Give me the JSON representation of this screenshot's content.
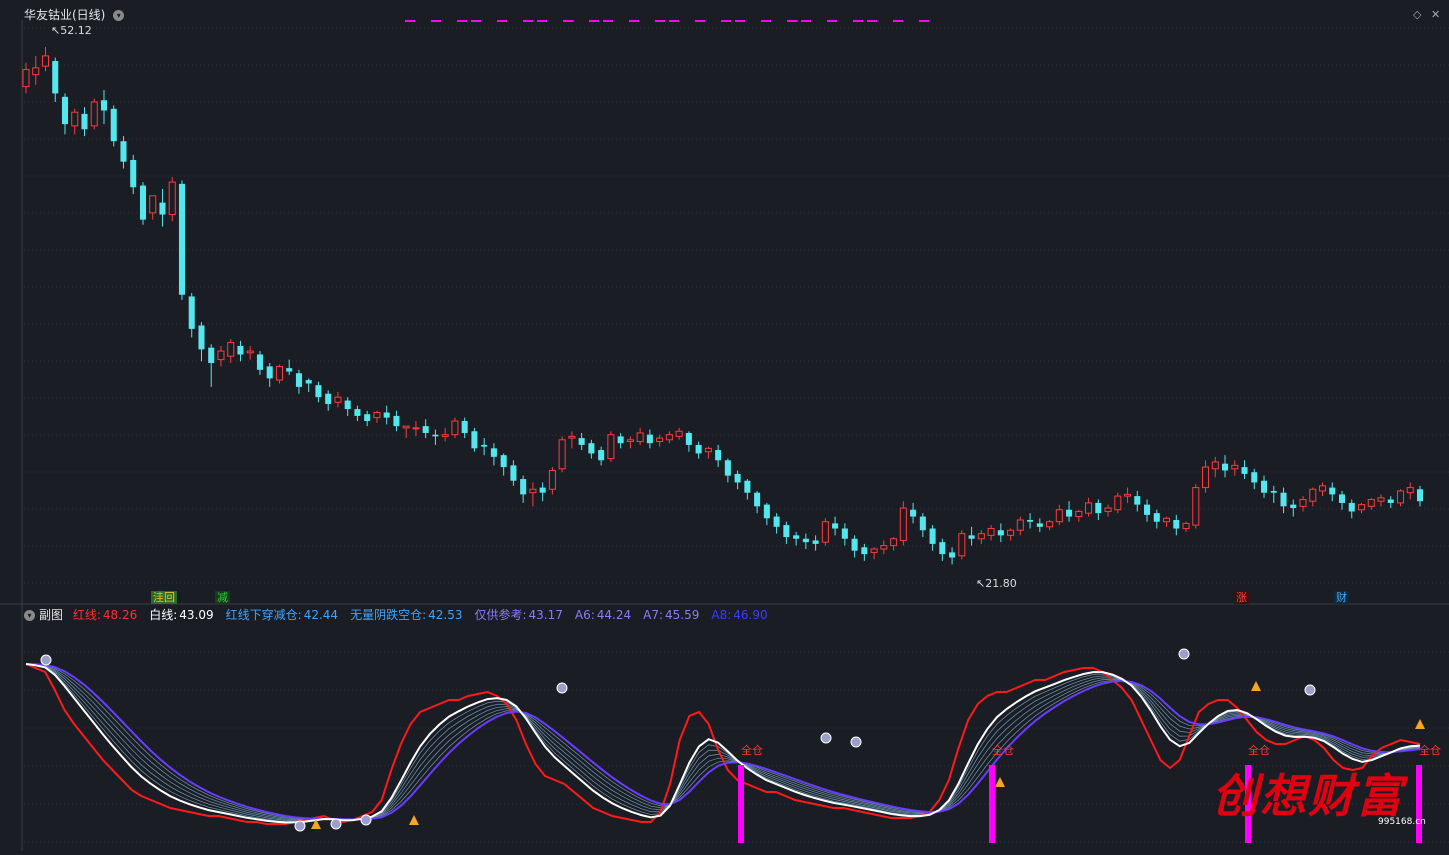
{
  "window": {
    "title": "华友钴业(日线)",
    "subchart_label": "副图"
  },
  "main_chart": {
    "high_label": "52.12",
    "low_label": "21.80",
    "markers": [
      {
        "text": "洼回",
        "color": "#f0c419"
      },
      {
        "text": "减",
        "color": "#2ec84a"
      },
      {
        "text": "涨",
        "color": "#ff4040"
      },
      {
        "text": "财",
        "color": "#41a7ff"
      }
    ]
  },
  "indicator": {
    "items": [
      {
        "name": "红线:",
        "value": "48.26",
        "name_color": "#ff3030",
        "value_color": "#ff3030"
      },
      {
        "name": "白线:",
        "value": "43.09",
        "name_color": "#ffffff",
        "value_color": "#ffffff"
      },
      {
        "name": "红线下穿减仓:",
        "value": "42.44",
        "name_color": "#3fa5ff",
        "value_color": "#3fa5ff"
      },
      {
        "name": "无量阴跌空仓:",
        "value": "42.53",
        "name_color": "#3fa5ff",
        "value_color": "#3fa5ff"
      },
      {
        "name": "仅供参考:",
        "value": "43.17",
        "name_color": "#8a7bff",
        "value_color": "#8a7bff"
      },
      {
        "name": "A6:",
        "value": "44.24",
        "name_color": "#8a7bff",
        "value_color": "#8a7bff"
      },
      {
        "name": "A7:",
        "value": "45.59",
        "name_color": "#8a7bff",
        "value_color": "#8a7bff"
      },
      {
        "name": "A8:",
        "value": "46.90",
        "name_color": "#3c3cff",
        "value_color": "#3c3cff"
      }
    ],
    "quan_label": "全仓"
  },
  "watermark": {
    "text": "创想财富",
    "url": "995168.cn"
  },
  "colors": {
    "up": "#ff3b3b",
    "down": "#54e8ee",
    "red_line": "#ff1a1a",
    "white_line": "#ffffff",
    "blue_line": "#6a3cff",
    "signal": "#ff00ff"
  },
  "chart_data": {
    "type": "candlestick",
    "ylim": [
      21.0,
      53.0
    ],
    "candles": [
      [
        49.8,
        51.2,
        50.8,
        49.4
      ],
      [
        50.5,
        51.6,
        50.9,
        49.9
      ],
      [
        51.0,
        52.12,
        51.6,
        50.7
      ],
      [
        51.3,
        51.5,
        49.4,
        48.9
      ],
      [
        49.2,
        49.4,
        47.6,
        47.0
      ],
      [
        47.5,
        48.5,
        48.3,
        47.0
      ],
      [
        48.2,
        48.6,
        47.3,
        46.9
      ],
      [
        47.5,
        49.1,
        48.9,
        47.3
      ],
      [
        49.0,
        49.6,
        48.4,
        47.6
      ],
      [
        48.5,
        48.7,
        46.6,
        46.3
      ],
      [
        46.6,
        46.9,
        45.4,
        45.0
      ],
      [
        45.5,
        45.8,
        43.9,
        43.5
      ],
      [
        44.0,
        44.2,
        42.0,
        41.7
      ],
      [
        42.4,
        42.8,
        43.4,
        42.0
      ],
      [
        43.0,
        43.8,
        42.3,
        41.6
      ],
      [
        42.3,
        44.5,
        44.2,
        41.9
      ],
      [
        44.1,
        44.3,
        37.6,
        37.3
      ],
      [
        37.5,
        37.7,
        35.6,
        35.1
      ],
      [
        35.8,
        36.0,
        34.4,
        33.7
      ],
      [
        34.5,
        34.7,
        33.6,
        32.2
      ],
      [
        33.8,
        34.6,
        34.3,
        33.4
      ],
      [
        34.0,
        35.0,
        34.8,
        33.6
      ],
      [
        34.6,
        34.9,
        34.1,
        33.7
      ],
      [
        34.2,
        34.6,
        34.3,
        33.8
      ],
      [
        34.1,
        34.3,
        33.2,
        32.9
      ],
      [
        33.4,
        33.6,
        32.7,
        32.2
      ],
      [
        32.6,
        33.5,
        33.4,
        32.4
      ],
      [
        33.3,
        33.8,
        33.1,
        32.9
      ],
      [
        33.0,
        33.2,
        32.2,
        31.8
      ],
      [
        32.6,
        32.7,
        32.4,
        31.9
      ],
      [
        32.3,
        32.5,
        31.6,
        31.3
      ],
      [
        31.8,
        32.0,
        31.2,
        30.8
      ],
      [
        31.3,
        31.9,
        31.6,
        31.0
      ],
      [
        31.4,
        31.6,
        30.9,
        30.5
      ],
      [
        30.9,
        31.1,
        30.5,
        30.2
      ],
      [
        30.6,
        30.8,
        30.2,
        29.9
      ],
      [
        30.4,
        30.8,
        30.7,
        30.1
      ],
      [
        30.7,
        31.1,
        30.4,
        30.0
      ],
      [
        30.5,
        30.8,
        29.9,
        29.6
      ],
      [
        29.8,
        29.9,
        29.9,
        29.2
      ],
      [
        29.8,
        30.2,
        29.8,
        29.3
      ],
      [
        29.9,
        30.3,
        29.5,
        29.2
      ],
      [
        29.4,
        29.7,
        29.3,
        28.8
      ],
      [
        29.3,
        29.8,
        29.4,
        29.0
      ],
      [
        29.4,
        30.4,
        30.2,
        29.2
      ],
      [
        30.2,
        30.4,
        29.5,
        29.2
      ],
      [
        29.6,
        29.8,
        28.6,
        28.4
      ],
      [
        28.8,
        29.2,
        28.7,
        28.2
      ],
      [
        28.6,
        28.9,
        28.1,
        27.6
      ],
      [
        28.2,
        28.3,
        27.5,
        27.0
      ],
      [
        27.6,
        27.9,
        26.7,
        26.4
      ],
      [
        26.8,
        27.0,
        25.9,
        25.4
      ],
      [
        26.0,
        26.6,
        26.2,
        25.2
      ],
      [
        26.3,
        26.6,
        26.0,
        25.5
      ],
      [
        26.2,
        27.5,
        27.3,
        25.9
      ],
      [
        27.4,
        29.3,
        29.1,
        27.2
      ],
      [
        29.2,
        29.6,
        29.3,
        28.6
      ],
      [
        29.2,
        29.5,
        28.8,
        28.5
      ],
      [
        28.9,
        29.1,
        28.3,
        28.0
      ],
      [
        28.5,
        28.7,
        27.9,
        27.6
      ],
      [
        28.0,
        29.6,
        29.4,
        27.8
      ],
      [
        29.3,
        29.5,
        28.9,
        28.6
      ],
      [
        29.0,
        29.3,
        29.1,
        28.6
      ],
      [
        29.0,
        29.8,
        29.5,
        28.8
      ],
      [
        29.4,
        29.7,
        28.9,
        28.6
      ],
      [
        29.0,
        29.4,
        29.2,
        28.7
      ],
      [
        29.1,
        29.6,
        29.4,
        28.9
      ],
      [
        29.3,
        29.8,
        29.6,
        29.1
      ],
      [
        29.5,
        29.6,
        28.8,
        28.4
      ],
      [
        28.8,
        29.0,
        28.3,
        28.0
      ],
      [
        28.4,
        28.7,
        28.6,
        28.0
      ],
      [
        28.5,
        28.8,
        27.9,
        27.5
      ],
      [
        27.9,
        28.0,
        27.0,
        26.6
      ],
      [
        27.1,
        27.3,
        26.6,
        26.2
      ],
      [
        26.7,
        26.8,
        26.0,
        25.6
      ],
      [
        26.0,
        26.1,
        25.2,
        24.8
      ],
      [
        25.3,
        25.4,
        24.5,
        24.1
      ],
      [
        24.6,
        24.8,
        24.0,
        23.6
      ],
      [
        24.1,
        24.3,
        23.4,
        23.0
      ],
      [
        23.5,
        23.7,
        23.3,
        22.9
      ],
      [
        23.3,
        23.6,
        23.1,
        22.7
      ],
      [
        23.2,
        23.5,
        23.0,
        22.6
      ],
      [
        23.1,
        24.5,
        24.3,
        22.9
      ],
      [
        24.2,
        24.6,
        23.9,
        23.5
      ],
      [
        23.9,
        24.2,
        23.3,
        22.9
      ],
      [
        23.3,
        23.5,
        22.6,
        22.2
      ],
      [
        22.8,
        23.0,
        22.4,
        22.0
      ],
      [
        22.5,
        22.8,
        22.7,
        22.1
      ],
      [
        22.7,
        23.2,
        22.9,
        22.4
      ],
      [
        22.9,
        23.4,
        23.3,
        22.6
      ],
      [
        23.2,
        25.5,
        25.1,
        22.9
      ],
      [
        25.0,
        25.4,
        24.6,
        24.2
      ],
      [
        24.6,
        24.8,
        23.8,
        23.4
      ],
      [
        23.9,
        24.1,
        23.0,
        22.6
      ],
      [
        23.1,
        23.3,
        22.4,
        22.0
      ],
      [
        22.5,
        22.8,
        22.2,
        21.8
      ],
      [
        22.3,
        23.8,
        23.6,
        22.1
      ],
      [
        23.5,
        24.0,
        23.3,
        22.9
      ],
      [
        23.3,
        23.8,
        23.6,
        23.0
      ],
      [
        23.5,
        24.1,
        23.9,
        23.2
      ],
      [
        23.8,
        24.2,
        23.5,
        23.1
      ],
      [
        23.5,
        23.9,
        23.8,
        23.2
      ],
      [
        23.8,
        24.6,
        24.4,
        23.5
      ],
      [
        24.4,
        24.8,
        24.3,
        23.9
      ],
      [
        24.2,
        24.5,
        24.0,
        23.7
      ],
      [
        24.0,
        24.4,
        24.3,
        23.8
      ],
      [
        24.3,
        25.3,
        25.0,
        24.1
      ],
      [
        25.0,
        25.5,
        24.6,
        24.3
      ],
      [
        24.6,
        25.0,
        24.9,
        24.3
      ],
      [
        24.8,
        25.7,
        25.4,
        24.6
      ],
      [
        25.4,
        25.6,
        24.8,
        24.4
      ],
      [
        24.9,
        25.3,
        25.1,
        24.6
      ],
      [
        25.0,
        26.0,
        25.8,
        24.8
      ],
      [
        25.8,
        26.3,
        25.9,
        25.4
      ],
      [
        25.8,
        26.1,
        25.3,
        24.9
      ],
      [
        25.3,
        25.6,
        24.7,
        24.3
      ],
      [
        24.8,
        25.0,
        24.3,
        23.9
      ],
      [
        24.3,
        24.6,
        24.5,
        24.0
      ],
      [
        24.4,
        24.7,
        23.9,
        23.5
      ],
      [
        23.9,
        24.3,
        24.2,
        23.7
      ],
      [
        24.1,
        26.5,
        26.3,
        23.9
      ],
      [
        26.3,
        27.9,
        27.5,
        26.0
      ],
      [
        27.4,
        28.1,
        27.8,
        26.9
      ],
      [
        27.7,
        28.2,
        27.3,
        26.9
      ],
      [
        27.4,
        27.9,
        27.6,
        27.0
      ],
      [
        27.5,
        27.9,
        27.1,
        26.8
      ],
      [
        27.2,
        27.4,
        26.6,
        26.2
      ],
      [
        26.7,
        27.0,
        26.0,
        25.7
      ],
      [
        26.1,
        26.4,
        26.0,
        25.4
      ],
      [
        26.0,
        26.3,
        25.2,
        24.8
      ],
      [
        25.3,
        25.6,
        25.1,
        24.6
      ],
      [
        25.2,
        25.8,
        25.6,
        24.9
      ],
      [
        25.5,
        26.3,
        26.2,
        25.2
      ],
      [
        26.1,
        26.6,
        26.4,
        25.8
      ],
      [
        26.3,
        26.6,
        25.9,
        25.5
      ],
      [
        25.9,
        26.1,
        25.4,
        25.0
      ],
      [
        25.4,
        25.6,
        24.9,
        24.5
      ],
      [
        25.0,
        25.4,
        25.3,
        24.8
      ],
      [
        25.2,
        25.7,
        25.6,
        25.0
      ],
      [
        25.5,
        25.9,
        25.7,
        25.2
      ],
      [
        25.6,
        25.8,
        25.4,
        25.1
      ],
      [
        25.4,
        26.2,
        26.1,
        25.2
      ],
      [
        26.0,
        26.6,
        26.3,
        25.6
      ],
      [
        26.2,
        26.4,
        25.5,
        25.2
      ]
    ],
    "subchart": {
      "ylim": [
        0,
        100
      ],
      "red_line": [
        88,
        86,
        84,
        75,
        65,
        58,
        52,
        46,
        40,
        35,
        30,
        25,
        22,
        20,
        18,
        16,
        15,
        14,
        13,
        12,
        12,
        11,
        10,
        9,
        9,
        8,
        8,
        8,
        9,
        10,
        11,
        12,
        10,
        9,
        10,
        12,
        14,
        20,
        35,
        48,
        58,
        64,
        66,
        68,
        70,
        70,
        72,
        73,
        74,
        72,
        68,
        60,
        48,
        38,
        32,
        30,
        28,
        24,
        20,
        16,
        14,
        12,
        11,
        10,
        9,
        9,
        14,
        28,
        50,
        62,
        64,
        58,
        45,
        35,
        30,
        28,
        26,
        24,
        24,
        22,
        20,
        19,
        18,
        17,
        16,
        16,
        15,
        14,
        13,
        12,
        11,
        11,
        11,
        12,
        14,
        20,
        30,
        46,
        60,
        68,
        72,
        74,
        74,
        76,
        78,
        80,
        80,
        82,
        84,
        85,
        86,
        86,
        84,
        80,
        76,
        70,
        60,
        50,
        40,
        36,
        40,
        52,
        64,
        68,
        70,
        70,
        66,
        60,
        54,
        50,
        48,
        48,
        50,
        52,
        50,
        46,
        40,
        36,
        35,
        36,
        42,
        46,
        48,
        50,
        49,
        48
      ]
    }
  }
}
